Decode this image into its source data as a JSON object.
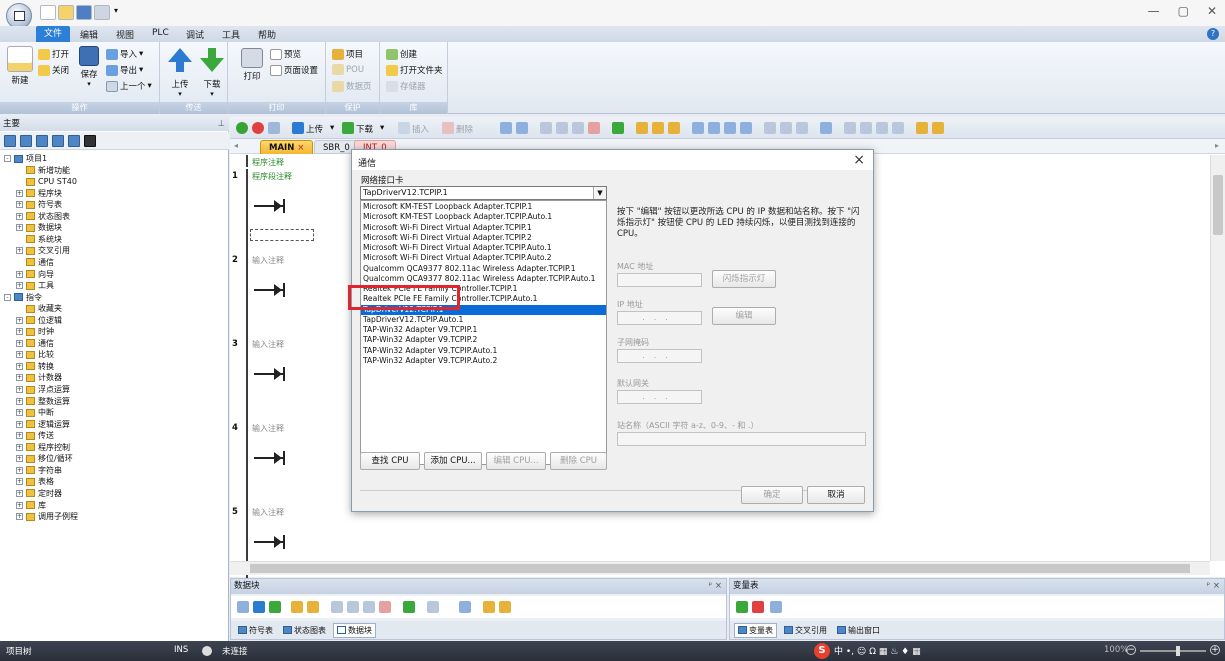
{
  "ribbon": {
    "tabs": [
      "文件",
      "编辑",
      "视图",
      "PLC",
      "调试",
      "工具",
      "帮助"
    ],
    "groups": {
      "operate": {
        "label": "操作",
        "new": "新建",
        "open": "打开",
        "close": "关闭",
        "save": "保存",
        "import": "导入",
        "export": "导出",
        "previous": "上一个"
      },
      "transfer": {
        "label": "传送",
        "upload": "上传",
        "download": "下载"
      },
      "print": {
        "label": "打印",
        "print": "打印",
        "preview": "预览",
        "page_setup": "页面设置"
      },
      "protect": {
        "label": "保护",
        "project": "项目",
        "pou": "POU",
        "datapage": "数据页"
      },
      "library": {
        "label": "库",
        "create": "创建",
        "open_folder": "打开文件夹",
        "memory": "存储器"
      }
    }
  },
  "left_pane": {
    "title": "主要",
    "tree": [
      {
        "label": "项目1",
        "level": 0,
        "expander": "-"
      },
      {
        "label": "新增功能",
        "level": 1,
        "expander": ""
      },
      {
        "label": "CPU ST40",
        "level": 1,
        "expander": ""
      },
      {
        "label": "程序块",
        "level": 1,
        "expander": "+"
      },
      {
        "label": "符号表",
        "level": 1,
        "expander": "+"
      },
      {
        "label": "状态图表",
        "level": 1,
        "expander": "+"
      },
      {
        "label": "数据块",
        "level": 1,
        "expander": "+"
      },
      {
        "label": "系统块",
        "level": 1,
        "expander": ""
      },
      {
        "label": "交叉引用",
        "level": 1,
        "expander": "+"
      },
      {
        "label": "通信",
        "level": 1,
        "expander": ""
      },
      {
        "label": "向导",
        "level": 1,
        "expander": "+"
      },
      {
        "label": "工具",
        "level": 1,
        "expander": "+"
      },
      {
        "label": "指令",
        "level": 0,
        "expander": "-"
      },
      {
        "label": "收藏夹",
        "level": 1,
        "expander": ""
      },
      {
        "label": "位逻辑",
        "level": 1,
        "expander": "+"
      },
      {
        "label": "时钟",
        "level": 1,
        "expander": "+"
      },
      {
        "label": "通信",
        "level": 1,
        "expander": "+"
      },
      {
        "label": "比较",
        "level": 1,
        "expander": "+"
      },
      {
        "label": "转换",
        "level": 1,
        "expander": "+"
      },
      {
        "label": "计数器",
        "level": 1,
        "expander": "+"
      },
      {
        "label": "浮点运算",
        "level": 1,
        "expander": "+"
      },
      {
        "label": "整数运算",
        "level": 1,
        "expander": "+"
      },
      {
        "label": "中断",
        "level": 1,
        "expander": "+"
      },
      {
        "label": "逻辑运算",
        "level": 1,
        "expander": "+"
      },
      {
        "label": "传送",
        "level": 1,
        "expander": "+"
      },
      {
        "label": "程序控制",
        "level": 1,
        "expander": "+"
      },
      {
        "label": "移位/循环",
        "level": 1,
        "expander": "+"
      },
      {
        "label": "字符串",
        "level": 1,
        "expander": "+"
      },
      {
        "label": "表格",
        "level": 1,
        "expander": "+"
      },
      {
        "label": "定时器",
        "level": 1,
        "expander": "+"
      },
      {
        "label": "库",
        "level": 1,
        "expander": "+"
      },
      {
        "label": "调用子例程",
        "level": 1,
        "expander": "+"
      }
    ]
  },
  "editor": {
    "toolbar": {
      "upload": "上传",
      "download": "下载",
      "insert": "插入",
      "delete": "删除"
    },
    "tabs": [
      "MAIN",
      "SBR_0",
      "INT_0"
    ],
    "program_comment": "程序注释",
    "networks": [
      {
        "num": "1",
        "comment": "程序段注释"
      },
      {
        "num": "2",
        "comment": "输入注释"
      },
      {
        "num": "3",
        "comment": "输入注释"
      },
      {
        "num": "4",
        "comment": "输入注释"
      },
      {
        "num": "5",
        "comment": "输入注释"
      }
    ]
  },
  "bottom": {
    "datablock": {
      "title": "数据块",
      "tabs": [
        "符号表",
        "状态图表",
        "数据块"
      ]
    },
    "vartable": {
      "title": "变量表",
      "tabs": [
        "变量表",
        "交叉引用",
        "输出窗口"
      ]
    }
  },
  "status": {
    "left": "项目树",
    "ins": "INS",
    "connection": "未连接",
    "zoom": "100%"
  },
  "dialog": {
    "title": "通信",
    "netcard_label": "网络接口卡",
    "selected": "TapDriverV12.TCPIP.1",
    "options": [
      "Microsoft KM-TEST Loopback Adapter.TCPIP.1",
      "Microsoft KM-TEST Loopback Adapter.TCPIP.Auto.1",
      "Microsoft Wi-Fi Direct Virtual Adapter.TCPIP.1",
      "Microsoft Wi-Fi Direct Virtual Adapter.TCPIP.2",
      "Microsoft Wi-Fi Direct Virtual Adapter.TCPIP.Auto.1",
      "Microsoft Wi-Fi Direct Virtual Adapter.TCPIP.Auto.2",
      "Qualcomm QCA9377 802.11ac Wireless Adapter.TCPIP.1",
      "Qualcomm QCA9377 802.11ac Wireless Adapter.TCPIP.Auto.1",
      "Realtek PCIe FE Family Controller.TCPIP.1",
      "Realtek PCIe FE Family Controller.TCPIP.Auto.1",
      "TapDriverV12.TCPIP.1",
      "TapDriverV12.TCPIP.Auto.1",
      "TAP-Win32 Adapter V9.TCPIP.1",
      "TAP-Win32 Adapter V9.TCPIP.2",
      "TAP-Win32 Adapter V9.TCPIP.Auto.1",
      "TAP-Win32 Adapter V9.TCPIP.Auto.2"
    ],
    "hint": "按下 \"编辑\" 按钮以更改所选 CPU 的 IP 数据和站名称。按下 \"闪烁指示灯\" 按钮使 CPU 的 LED 持续闪烁，以便目测找到连接的 CPU。",
    "mac_label": "MAC 地址",
    "blink_button": "闪烁指示灯",
    "ip_label": "IP 地址",
    "edit_button": "编辑",
    "subnet_label": "子网掩码",
    "gateway_label": "默认网关",
    "station_label": "站名称（ASCII 字符 a-z、0-9、- 和 .）",
    "find_cpu": "查找 CPU",
    "add_cpu": "添加 CPU...",
    "edit_cpu": "编辑 CPU...",
    "delete_cpu": "删除 CPU",
    "ok": "确定",
    "cancel": "取消",
    "ip_dots": "...",
    "subnet_dots": "...",
    "gateway_dots": "...",
    "close_glyph": "×"
  }
}
